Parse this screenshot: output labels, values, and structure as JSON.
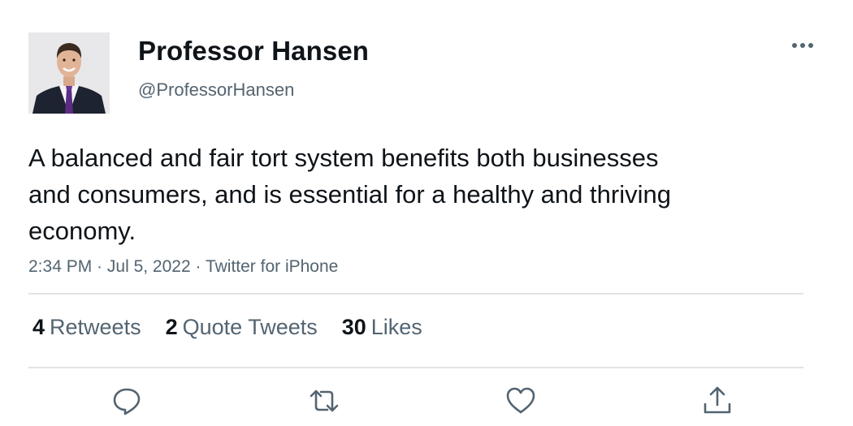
{
  "user": {
    "display_name": "Professor Hansen",
    "handle": "@ProfessorHansen",
    "avatar_icon": "profile-photo"
  },
  "tweet": {
    "text": "A balanced and fair tort system benefits both businesses and consumers, and is essential for a healthy and thriving economy.",
    "time": "2:34 PM",
    "separator": " · ",
    "date": "Jul 5, 2022",
    "source": "Twitter for iPhone"
  },
  "stats": {
    "retweets_count": "4",
    "retweets_label": "Retweets",
    "quotes_count": "2",
    "quotes_label": "Quote Tweets",
    "likes_count": "30",
    "likes_label": "Likes"
  },
  "actions": {
    "reply_icon": "reply-icon",
    "retweet_icon": "retweet-icon",
    "like_icon": "heart-icon",
    "share_icon": "share-icon"
  },
  "colors": {
    "text_primary": "#0f1419",
    "text_secondary": "#536471",
    "divider": "#e1e4e7",
    "tie": "#5b2c83"
  }
}
